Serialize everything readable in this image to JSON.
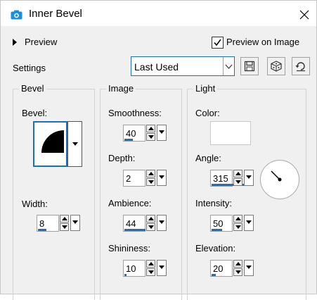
{
  "window": {
    "title": "Inner Bevel"
  },
  "preview": {
    "label": "Preview",
    "preview_on_image_label": "Preview on Image",
    "preview_on_image_checked": true
  },
  "settings": {
    "label": "Settings",
    "preset_value": "Last Used"
  },
  "bevel_group": {
    "title": "Bevel",
    "bevel_label": "Bevel:",
    "width_label": "Width:",
    "width_value": "8"
  },
  "image_group": {
    "title": "Image",
    "smoothness_label": "Smoothness:",
    "smoothness_value": "40",
    "depth_label": "Depth:",
    "depth_value": "2",
    "ambience_label": "Ambience:",
    "ambience_value": "44",
    "shininess_label": "Shininess:",
    "shininess_value": "10"
  },
  "light_group": {
    "title": "Light",
    "color_label": "Color:",
    "color_value": "#ffffff",
    "angle_label": "Angle:",
    "angle_value": "315",
    "intensity_label": "Intensity:",
    "intensity_value": "50",
    "elevation_label": "Elevation:",
    "elevation_value": "20"
  },
  "colors": {
    "accent": "#1a6fc4",
    "window_bg": "#f0f0f0"
  },
  "icons": [
    "camera-icon",
    "close-icon",
    "save-preset-icon",
    "dice-icon",
    "reset-icon"
  ]
}
